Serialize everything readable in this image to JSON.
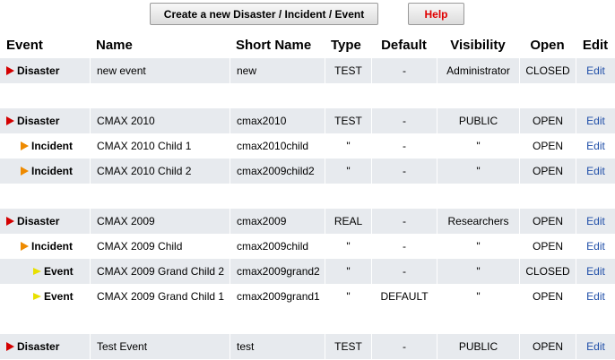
{
  "toolbar": {
    "create_label": "Create a new Disaster / Incident / Event",
    "help_label": "Help",
    "help_color": "#e00000"
  },
  "columns": {
    "event": "Event",
    "name": "Name",
    "short_name": "Short Name",
    "type": "Type",
    "default": "Default",
    "visibility": "Visibility",
    "open": "Open",
    "edit": "Edit"
  },
  "rows": [
    {
      "event": "Disaster",
      "level": 0,
      "name": "new event",
      "short_name": "new",
      "type": "TEST",
      "default": "-",
      "visibility": "Administrator",
      "open": "CLOSED",
      "edit": "Edit"
    },
    {
      "event": "Disaster",
      "level": 0,
      "name": "CMAX 2010",
      "short_name": "cmax2010",
      "type": "TEST",
      "default": "-",
      "visibility": "PUBLIC",
      "open": "OPEN",
      "edit": "Edit"
    },
    {
      "event": "Incident",
      "level": 1,
      "name": "CMAX 2010 Child 1",
      "short_name": "cmax2010child",
      "type": "\"",
      "default": "-",
      "visibility": "\"",
      "open": "OPEN",
      "edit": "Edit"
    },
    {
      "event": "Incident",
      "level": 1,
      "name": "CMAX 2010 Child 2",
      "short_name": "cmax2009child2",
      "type": "\"",
      "default": "-",
      "visibility": "\"",
      "open": "OPEN",
      "edit": "Edit"
    },
    {
      "event": "Disaster",
      "level": 0,
      "name": "CMAX 2009",
      "short_name": "cmax2009",
      "type": "REAL",
      "default": "-",
      "visibility": "Researchers",
      "open": "OPEN",
      "edit": "Edit"
    },
    {
      "event": "Incident",
      "level": 1,
      "name": "CMAX 2009 Child",
      "short_name": "cmax2009child",
      "type": "\"",
      "default": "-",
      "visibility": "\"",
      "open": "OPEN",
      "edit": "Edit"
    },
    {
      "event": "Event",
      "level": 2,
      "name": "CMAX 2009 Grand Child 2",
      "short_name": "cmax2009grand2",
      "type": "\"",
      "default": "-",
      "visibility": "\"",
      "open": "CLOSED",
      "edit": "Edit"
    },
    {
      "event": "Event",
      "level": 2,
      "name": "CMAX 2009 Grand Child 1",
      "short_name": "cmax2009grand1",
      "type": "\"",
      "default": "DEFAULT",
      "visibility": "\"",
      "open": "OPEN",
      "edit": "Edit"
    },
    {
      "event": "Disaster",
      "level": 0,
      "name": "Test Event",
      "short_name": "test",
      "type": "TEST",
      "default": "-",
      "visibility": "PUBLIC",
      "open": "OPEN",
      "edit": "Edit"
    }
  ],
  "colors": {
    "row_shade": "#e7eaee",
    "link": "#1f4ea8",
    "disaster_marker": "#d40000",
    "incident_marker": "#ee8a00",
    "event_marker": "#e8e000"
  }
}
